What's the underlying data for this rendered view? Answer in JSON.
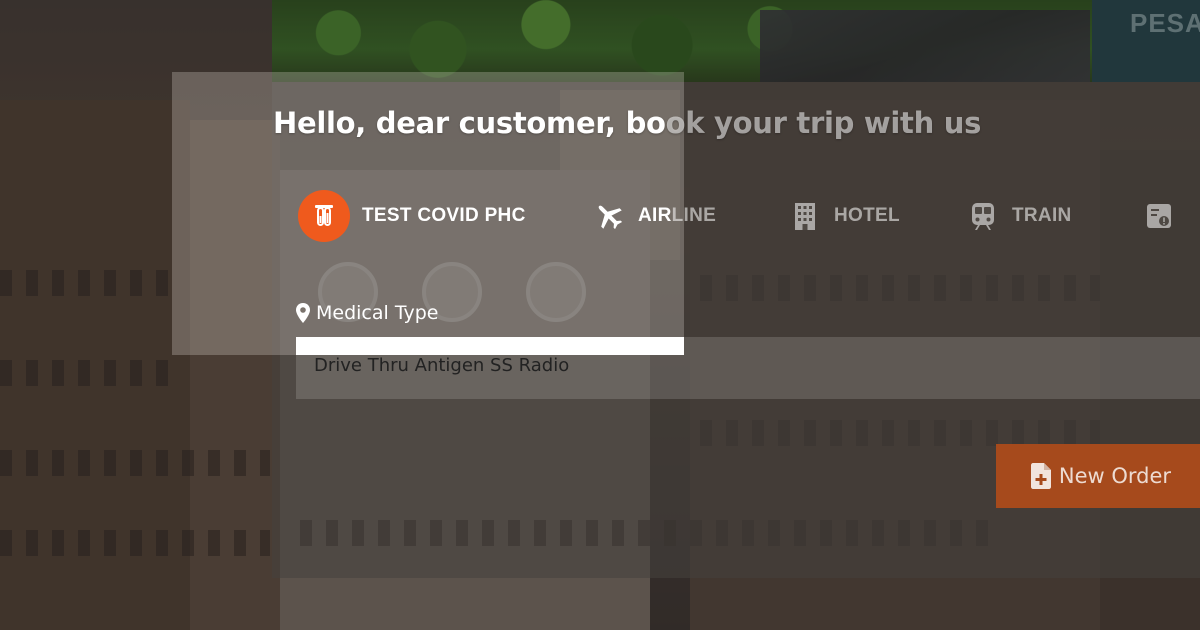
{
  "corner_text": "PESA",
  "header": {
    "title_main": "Hello, dear customer, bo",
    "title_fade": "ok your trip with us"
  },
  "tabs": [
    {
      "label": "TEST COVID PHC",
      "icon": "test-tube-icon",
      "active": true
    },
    {
      "label_bright": "AIR",
      "label_fade": "LINE",
      "icon": "airplane-icon",
      "active": false
    },
    {
      "label": "HOTEL",
      "icon": "building-icon",
      "active": false
    },
    {
      "label": "TRAIN",
      "icon": "train-icon",
      "active": false
    },
    {
      "label": "",
      "icon": "ticket-icon",
      "active": false
    }
  ],
  "form": {
    "medical_type_label": "Medical Type",
    "medical_type_value": "Drive Thru Antigen SS Radio"
  },
  "actions": {
    "new_order_label": "New Order"
  },
  "colors": {
    "accent": "#ef5a1d",
    "button": "#a64a1c"
  }
}
